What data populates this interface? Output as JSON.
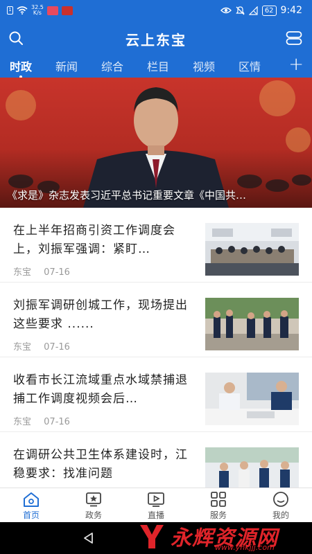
{
  "status_bar": {
    "speed_value": "32.5",
    "speed_unit": "K/s",
    "sim_label": "1",
    "battery": "62",
    "time": "9:42"
  },
  "header": {
    "title": "云上东宝"
  },
  "tabs": [
    "时政",
    "新闻",
    "综合",
    "栏目",
    "视频",
    "区情"
  ],
  "add_tab": "+",
  "banner": {
    "caption": "《求是》杂志发表习近平总书记重要文章《中国共…"
  },
  "news": [
    {
      "title": "在上半年招商引资工作调度会上，刘振军强调：紧盯…",
      "source": "东宝",
      "date": "07-16"
    },
    {
      "title": "刘振军调研创城工作，现场提出这些要求 ......",
      "source": "东宝",
      "date": "07-16"
    },
    {
      "title": "收看市长江流域重点水域禁捕退捕工作调度视频会后…",
      "source": "东宝",
      "date": "07-16"
    },
    {
      "title": "在调研公共卫生体系建设时，江稳要求：找准问题",
      "source": "",
      "date": ""
    }
  ],
  "bottom_nav": [
    {
      "label": "首页",
      "icon": "home-icon"
    },
    {
      "label": "政务",
      "icon": "star-box-icon"
    },
    {
      "label": "直播",
      "icon": "video-icon"
    },
    {
      "label": "服务",
      "icon": "grid-icon"
    },
    {
      "label": "我的",
      "icon": "profile-icon"
    }
  ],
  "watermark": {
    "text": "永辉资源网",
    "url": "www.yhkjjj.com"
  },
  "colors": {
    "brand": "#1f6ed4",
    "text": "#222222",
    "meta": "#999999",
    "watermark": "#e0242a"
  }
}
